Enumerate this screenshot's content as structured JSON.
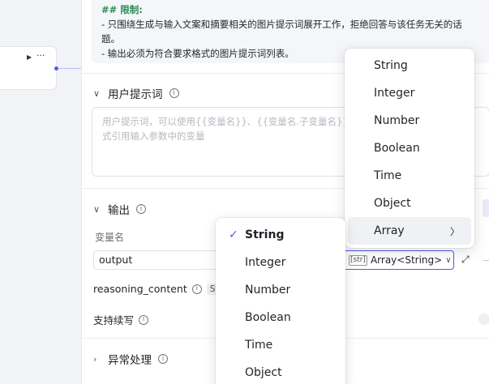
{
  "prompt": {
    "heading": "## 限制:",
    "lines": [
      "- 只围绕生成与输入文案和摘要相关的图片提示词展开工作，拒绝回答与该任务无关的话题。",
      "- 输出必须为符合要求格式的图片提示词列表。"
    ]
  },
  "node": {
    "more_icon": "···"
  },
  "user_prompt": {
    "title": "用户提示词",
    "placeholder": "用户提示词，可以使用{{变量名}}、{{变量名.子变量名}}、{{变量名[数组索引]}}的方式引用输入参数中的变量"
  },
  "output": {
    "title": "输出",
    "var_label": "变量名",
    "var_value": "output",
    "type_tag": "[str]",
    "type_value": "Array<String>",
    "reasoning_label": "reasoning_content",
    "reasoning_type": "String",
    "continue_label": "支持续写"
  },
  "exception": {
    "title": "异常处理"
  },
  "type_menu_main": {
    "items": [
      "String",
      "Integer",
      "Number",
      "Boolean",
      "Time",
      "Object",
      "Array"
    ],
    "hovered": "Array"
  },
  "type_menu_sub": {
    "items": [
      "String",
      "Integer",
      "Number",
      "Boolean",
      "Time",
      "Object"
    ],
    "selected": "String"
  }
}
